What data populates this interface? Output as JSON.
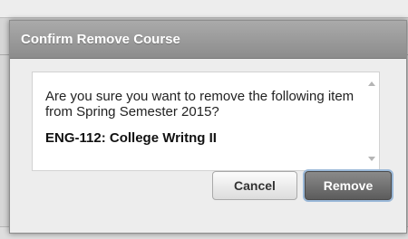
{
  "dialog": {
    "title": "Confirm Remove Course",
    "message": "Are you sure you want to remove the following item from Spring Semester 2015?",
    "item_name": "ENG-112: College Writng II",
    "cancel_label": "Cancel",
    "remove_label": "Remove"
  },
  "colors": {
    "header_gradient_top": "#aaaaaa",
    "header_gradient_bottom": "#8c8c8c",
    "remove_button": "#6e6e6e",
    "focus_ring": "#9ab8d8"
  },
  "icons": [
    "scroll-up-arrow-icon",
    "scroll-down-arrow-icon"
  ]
}
